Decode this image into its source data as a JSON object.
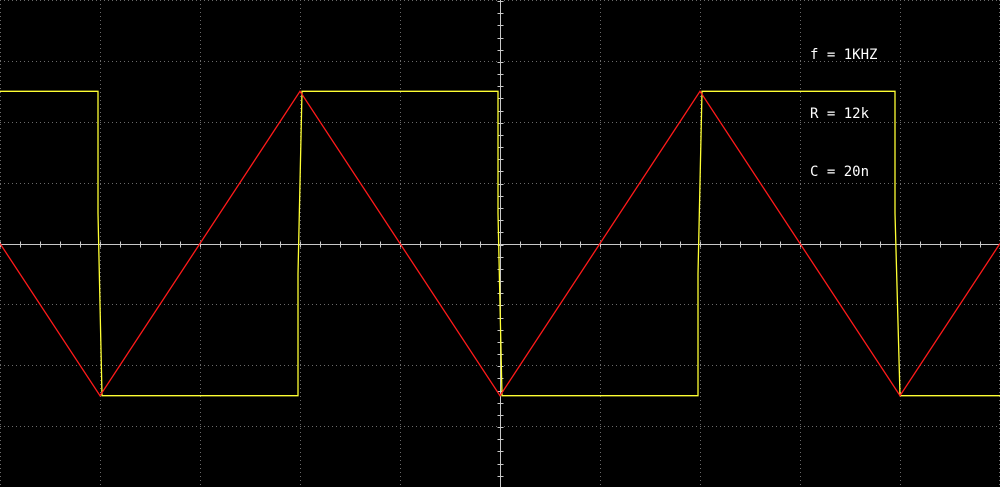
{
  "params": {
    "freq": "f = 1KHZ",
    "resistance": "R = 12k",
    "capacitance": "C = 20n"
  },
  "colors": {
    "background": "#000000",
    "grid": "#6a6a6a",
    "axis": "#c8c8c8",
    "square_trace": "#ffff33",
    "triangle_trace": "#ff1a1a",
    "text": "#ffffff"
  },
  "chart_data": {
    "type": "line",
    "grid": true,
    "xlim": [
      0,
      10
    ],
    "ylim": [
      -4,
      4
    ],
    "series": [
      {
        "x": [
          0,
          0.98,
          0.98,
          1.02,
          1.02,
          2.98,
          2.98,
          3.02,
          3.02,
          4.98,
          4.98,
          5.02,
          5.02,
          6.98,
          6.98,
          7.02,
          7.02,
          8.95,
          8.95,
          9.0,
          9.0,
          10
        ],
        "y": [
          2.5,
          2.5,
          0.5,
          -2.5,
          -2.5,
          -2.5,
          -0.5,
          2.5,
          2.5,
          2.5,
          0.5,
          -2.5,
          -2.5,
          -2.5,
          -0.5,
          2.5,
          2.5,
          2.5,
          0.5,
          -2.5,
          -2.5,
          -2.5
        ]
      },
      {
        "x": [
          0,
          1.0,
          3.0,
          5.0,
          7.0,
          9.0,
          10
        ],
        "y": [
          0.0,
          -2.5,
          2.5,
          -2.5,
          2.5,
          -2.5,
          0.0
        ]
      }
    ]
  }
}
